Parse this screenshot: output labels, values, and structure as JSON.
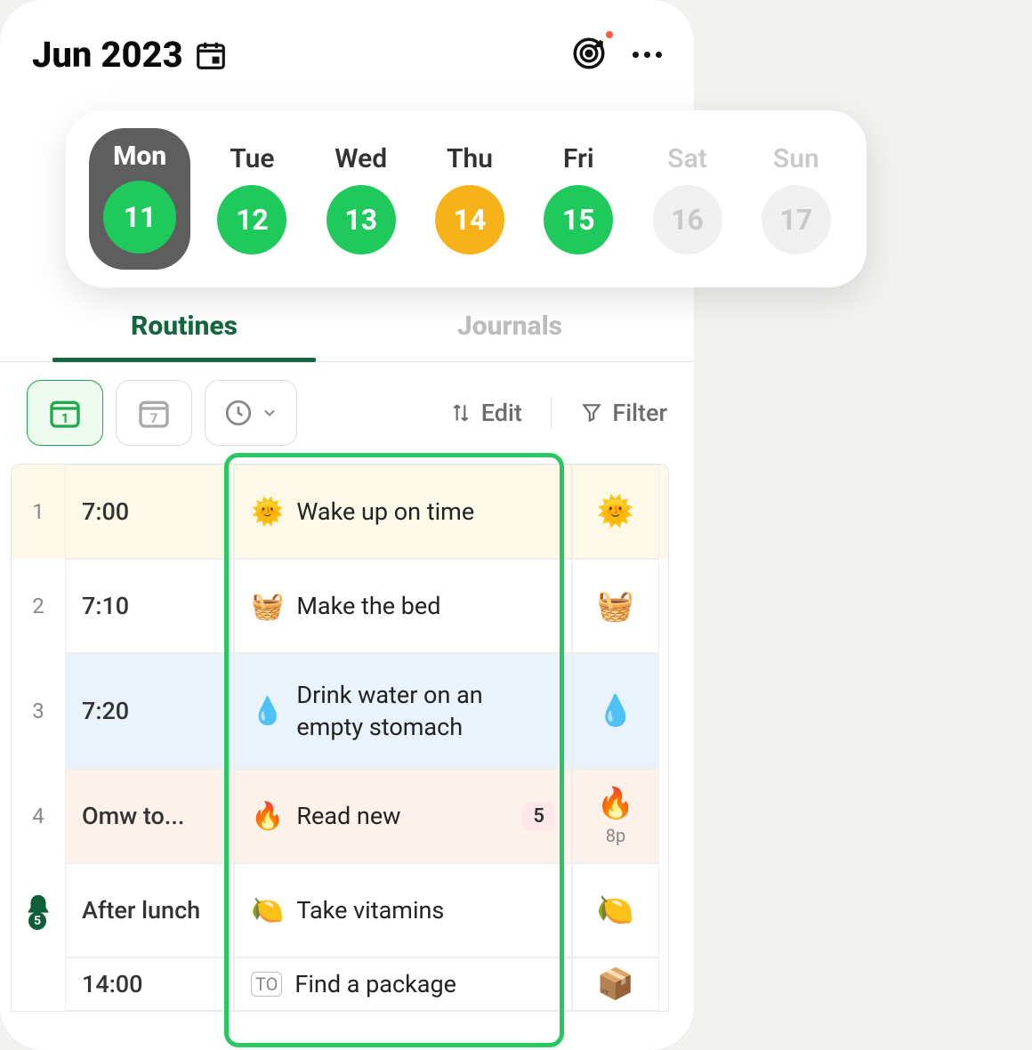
{
  "header": {
    "title": "Jun 2023"
  },
  "week": [
    {
      "label": "Mon",
      "num": "11",
      "color": "green",
      "selected": true,
      "muted": false
    },
    {
      "label": "Tue",
      "num": "12",
      "color": "green",
      "selected": false,
      "muted": false
    },
    {
      "label": "Wed",
      "num": "13",
      "color": "green",
      "selected": false,
      "muted": false
    },
    {
      "label": "Thu",
      "num": "14",
      "color": "orange",
      "selected": false,
      "muted": false
    },
    {
      "label": "Fri",
      "num": "15",
      "color": "green",
      "selected": false,
      "muted": false
    },
    {
      "label": "Sat",
      "num": "16",
      "color": "none",
      "selected": false,
      "muted": true
    },
    {
      "label": "Sun",
      "num": "17",
      "color": "none",
      "selected": false,
      "muted": true
    }
  ],
  "tabs": {
    "routines": "Routines",
    "journals": "Journals"
  },
  "toolbar": {
    "edit": "Edit",
    "filter": "Filter"
  },
  "bell_badge": "5",
  "rows": [
    {
      "idx": "1",
      "time": "7:00",
      "emoji": "🌞",
      "task": "Wake up on time",
      "status_emoji": "🌞",
      "badge": "",
      "sub": "",
      "bg": "yellow"
    },
    {
      "idx": "2",
      "time": "7:10",
      "emoji": "🧺",
      "task": "Make the bed",
      "status_emoji": "🧺",
      "badge": "",
      "sub": "",
      "bg": ""
    },
    {
      "idx": "3",
      "time": "7:20",
      "emoji": "💧",
      "task": "Drink water on an empty stomach",
      "status_emoji": "💧",
      "badge": "",
      "sub": "",
      "bg": "blue"
    },
    {
      "idx": "4",
      "time": "Omw to...",
      "emoji": "🔥",
      "task": "Read new",
      "status_emoji": "🔥",
      "badge": "5",
      "sub": "8p",
      "bg": "peach"
    },
    {
      "idx": "bell",
      "time": "After lunch",
      "emoji": "🍋",
      "task": "Take vitamins",
      "status_emoji": "🍋",
      "badge": "",
      "sub": "",
      "bg": ""
    },
    {
      "idx": "",
      "time": "14:00",
      "emoji": "",
      "task": "Find a package",
      "status_emoji": "📦",
      "badge": "",
      "sub": "",
      "bg": ""
    }
  ]
}
